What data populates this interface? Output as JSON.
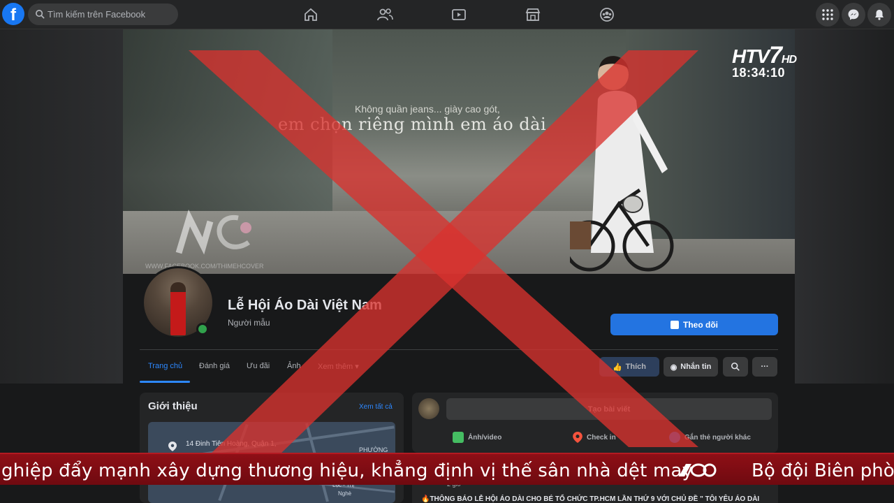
{
  "topbar": {
    "logo": "f",
    "search_placeholder": "Tìm kiếm trên Facebook",
    "nav_icons": [
      "home-icon",
      "friends-icon",
      "watch-icon",
      "marketplace-icon",
      "groups-icon"
    ],
    "right_icons": [
      "menu-grid-icon",
      "messenger-icon",
      "notifications-icon"
    ]
  },
  "cover": {
    "quote_line1": "Không quần jeans... giày cao gót,",
    "quote_line2": "em chọn riêng mình em áo dài",
    "watermark": "WWW.FACEBOOK.COM/THIMEHCOVER"
  },
  "broadcast": {
    "channel_logo": "HTV",
    "channel_seven": "7",
    "channel_hd": "HD",
    "time": "18:34:10"
  },
  "profile": {
    "name": "Lễ Hội Áo Dài Việt Nam",
    "category": "Người mẫu",
    "follow_label": "Theo dõi"
  },
  "tabs": [
    "Trang chủ",
    "Đánh giá",
    "Ưu đãi",
    "Ảnh",
    "Xem thêm"
  ],
  "actions": {
    "like": "Thích",
    "message": "Nhắn tin"
  },
  "intro": {
    "title": "Giới thiệu",
    "see_all": "Xem tất cả",
    "address": "14 Đinh Tiên Hoàng, Quận 1,",
    "map_ward": "PHƯỜNG",
    "map_loc": "Lộc - Thị",
    "map_ng": "Nghè"
  },
  "post": {
    "create": "Tạo bài viết",
    "photo_video": "Ảnh/video",
    "checkin": "Check in",
    "tag": "Gắn thẻ người khác"
  },
  "feed": {
    "meta": "2 giờ · ",
    "text": "🔥THÔNG BÁO LỄ HỘI ÁO DÀI CHO BÉ TỔ CHỨC TP.HCM LẦN THỨ 9 VỚI CHỦ ĐỀ \" TÔI YÊU ÁO DÀI"
  },
  "ticker": {
    "text": "ghiệp đẩy mạnh xây dựng thương hiệu, khẳng định vị thế sân nhà dệt may",
    "text2": "Bộ đội Biên phòn"
  },
  "colors": {
    "accent": "#2374e1",
    "red_cross": "#d9322e",
    "ticker": "#8e0f16"
  }
}
